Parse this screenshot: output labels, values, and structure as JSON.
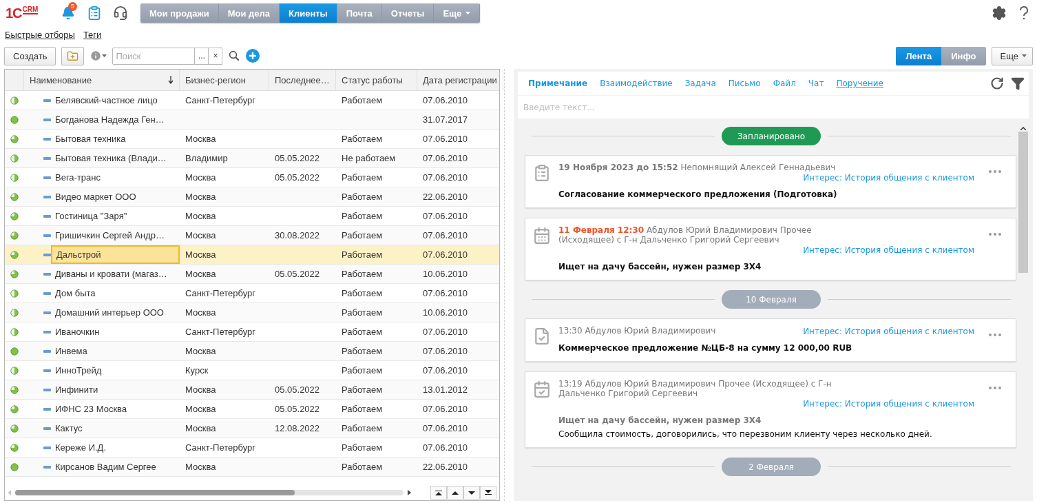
{
  "header": {
    "logo": {
      "mark": "1С",
      "text": "CRM"
    },
    "notifications": {
      "count": "5"
    },
    "nav": [
      {
        "label": "Мои продажи",
        "selected": false,
        "kind": "link"
      },
      {
        "label": "Мои дела",
        "selected": false,
        "kind": "link"
      },
      {
        "label": "Клиенты",
        "selected": true,
        "kind": "link"
      },
      {
        "label": "Почта",
        "selected": false,
        "kind": "link"
      },
      {
        "label": "Отчеты",
        "selected": false,
        "kind": "link"
      },
      {
        "label": "Еще",
        "selected": false,
        "kind": "menu"
      }
    ]
  },
  "filters": [
    "Быстрые отборы",
    "Теги"
  ],
  "toolbar": {
    "create": "Создать",
    "search": {
      "placeholder": "Поиск",
      "more": "...",
      "clear": "×"
    },
    "view_switch": [
      {
        "label": "Лента",
        "selected": true
      },
      {
        "label": "Инфо",
        "selected": false
      }
    ],
    "more": "Еще"
  },
  "table": {
    "columns": [
      {
        "label": "Наименование",
        "sorted": true
      },
      {
        "label": "Бизнес-регион",
        "sorted": false
      },
      {
        "label": "Последнее…",
        "sorted": false
      },
      {
        "label": "Статус работы",
        "sorted": false
      },
      {
        "label": "Дата регистрации",
        "sorted": false
      }
    ],
    "rows": [
      {
        "kind": "half",
        "name": "Белявский-частное лицо",
        "region": "Санкт-Петербург",
        "status": "Работаем",
        "date": "07.06.2010",
        "selected": false
      },
      {
        "kind": "full",
        "name": "Богданова Надежда Ген…",
        "date": "31.07.2017",
        "selected": false
      },
      {
        "kind": "most",
        "name": "Бытовая техника",
        "region": "Москва",
        "status": "Работаем",
        "date": "07.06.2010",
        "selected": false
      },
      {
        "kind": "half",
        "name": "Бытовая техника (Влади…",
        "region": "Владимир",
        "last": "05.05.2022",
        "status": "Не работаем",
        "date": "07.06.2010",
        "selected": false
      },
      {
        "kind": "half",
        "name": "Вега-транс",
        "region": "Москва",
        "last": "05.05.2022",
        "status": "Работаем",
        "date": "07.06.2010",
        "selected": false
      },
      {
        "kind": "most",
        "name": "Видео маркет ООО",
        "region": "Москва",
        "status": "Работаем",
        "date": "22.06.2010",
        "selected": false
      },
      {
        "kind": "most",
        "name": "Гостиница \"Заря\"",
        "region": "Москва",
        "status": "Работаем",
        "date": "07.06.2010",
        "selected": false
      },
      {
        "kind": "most",
        "name": "Гришичкин Сергей Андр…",
        "region": "Москва",
        "last": "30.08.2022",
        "status": "Работаем",
        "date": "07.06.2010",
        "selected": false
      },
      {
        "kind": "most",
        "name": "Дальстрой",
        "region": "Москва",
        "status": "Работаем",
        "date": "07.06.2010",
        "selected": true
      },
      {
        "kind": "most",
        "name": "Диваны и кровати (магаз…",
        "region": "Москва",
        "last": "05.05.2022",
        "status": "Работаем",
        "date": "10.06.2010",
        "selected": false
      },
      {
        "kind": "half",
        "name": "Дом быта",
        "region": "Санкт-Петербург",
        "status": "Работаем",
        "date": "07.06.2010",
        "selected": false
      },
      {
        "kind": "half",
        "name": "Домашний интерьер ООО",
        "region": "Москва",
        "status": "Работаем",
        "date": "10.06.2010",
        "selected": false
      },
      {
        "kind": "half",
        "name": "Иваночкин",
        "region": "Санкт-Петербург",
        "status": "Работаем",
        "date": "07.06.2010",
        "selected": false
      },
      {
        "kind": "full",
        "name": "Инвема",
        "region": "Москва",
        "status": "Работаем",
        "date": "07.06.2010",
        "selected": false
      },
      {
        "kind": "half",
        "name": "ИнноТрейд",
        "region": "Курск",
        "status": "Работаем",
        "date": "07.06.2010",
        "selected": false
      },
      {
        "kind": "most",
        "name": "Инфинити",
        "region": "Москва",
        "last": "05.05.2022",
        "status": "Работаем",
        "date": "13.01.2012",
        "selected": false
      },
      {
        "kind": "most",
        "name": "ИФНС 23 Москва",
        "region": "Москва",
        "last": "05.05.2022",
        "status": "Работаем",
        "date": "07.06.2010",
        "selected": false
      },
      {
        "kind": "most",
        "name": "Кактус",
        "region": "Москва",
        "last": "12.08.2022",
        "status": "Работаем",
        "date": "07.06.2010",
        "selected": false
      },
      {
        "kind": "most",
        "name": "Кереже И.Д.",
        "region": "Санкт-Петербург",
        "status": "Работаем",
        "date": "07.06.2010",
        "selected": false
      },
      {
        "kind": "full",
        "name": "Кирсанов Вадим Сергее",
        "region": "Москва",
        "status": "Работаем",
        "date": "22.06.2010",
        "selected": false
      }
    ]
  },
  "feed": {
    "tabs": [
      {
        "label": "Примечание",
        "selected": true,
        "underlined": false
      },
      {
        "label": "Взаимодействие",
        "selected": false,
        "underlined": false
      },
      {
        "label": "Задача",
        "selected": false,
        "underlined": false
      },
      {
        "label": "Письмо",
        "selected": false,
        "underlined": false
      },
      {
        "label": "Файл",
        "selected": false,
        "underlined": false
      },
      {
        "label": "Чат",
        "selected": false,
        "underlined": false
      },
      {
        "label": "Поручение",
        "selected": false,
        "underlined": true
      }
    ],
    "input": {
      "placeholder": "Введите текст..."
    },
    "items": [
      {
        "kind": "separator",
        "label": "Запланировано",
        "color": "#1f9a55"
      },
      {
        "kind": "task",
        "header": "**19 Ноября 2023 до 15:52** Непомнящий Алексей Геннадьевич",
        "overdue": false,
        "interest": "Интерес: История общения с клиентом",
        "title": "Согласование коммерческого предложения (Подготовка)",
        "title_muted": false
      },
      {
        "kind": "meeting",
        "header": "**11 Февраля 12:30** Абдулов Юрий Владимирович Прочее (Исходящее) с Г-н Дальченко Григорий Сергеевич",
        "overdue": true,
        "interest": "Интерес: История общения с клиентом",
        "title": "Ищет на дачу бассейн, нужен размер 3Х4",
        "title_muted": false
      },
      {
        "kind": "separator",
        "label": "10 Февраля",
        "color": "#a3acb9"
      },
      {
        "kind": "document",
        "header": "13:30 Абдулов Юрий Владимирович",
        "interest": "Интерес: История общения с клиентом",
        "title": "Коммерческое предложение №ЦБ-8 на сумму 12 000,00 RUB",
        "title_muted": false
      },
      {
        "kind": "meeting-done",
        "header": "13:19 Абдулов Юрий Владимирович Прочее (Исходящее) с Г-н Дальченко Григорий Сергеевич",
        "interest": "Интерес: История общения с клиентом",
        "title": "Ищет на дачу бассейн, нужен размер 3Х4",
        "title_muted": true,
        "note": "Сообщила стоимость, договорились, что перезвоним клиенту через несколько дней."
      },
      {
        "kind": "separator",
        "label": "2 Февраля",
        "color": "#a3acb9"
      }
    ]
  }
}
